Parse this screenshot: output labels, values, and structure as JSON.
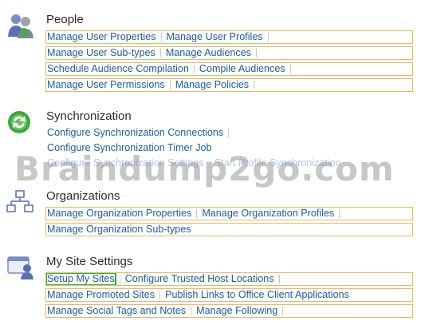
{
  "sections": [
    {
      "title": "People",
      "rows": [
        [
          "Manage User Properties",
          "Manage User Profiles"
        ],
        [
          "Manage User Sub-types",
          "Manage Audiences"
        ],
        [
          "Schedule Audience Compilation",
          "Compile Audiences"
        ],
        [
          "Manage User Permissions",
          "Manage Policies"
        ]
      ]
    },
    {
      "title": "Synchronization",
      "rows": [
        [
          "Configure Synchronization Connections"
        ],
        [
          "Configure Synchronization Timer Job"
        ],
        [
          "Configure Synchronization Settings",
          "Start Profile Synchronization"
        ]
      ]
    },
    {
      "title": "Organizations",
      "rows": [
        [
          "Manage Organization Properties",
          "Manage Organization Profiles"
        ],
        [
          "Manage Organization Sub-types"
        ]
      ]
    },
    {
      "title": "My Site Settings",
      "rows": [
        [
          "Setup My Sites",
          "Configure Trusted Host Locations"
        ],
        [
          "Manage Promoted Sites",
          "Publish Links to Office Client Applications"
        ],
        [
          "Manage Social Tags and Notes",
          "Manage Following"
        ]
      ]
    }
  ],
  "watermark": "Braindump2go.com",
  "colors": {
    "link": "#1a5fa8",
    "row_border": "#e8b860",
    "selected": "#1dbb2a"
  },
  "icons": [
    "people-icon",
    "sync-icon",
    "org-chart-icon",
    "my-site-icon"
  ]
}
